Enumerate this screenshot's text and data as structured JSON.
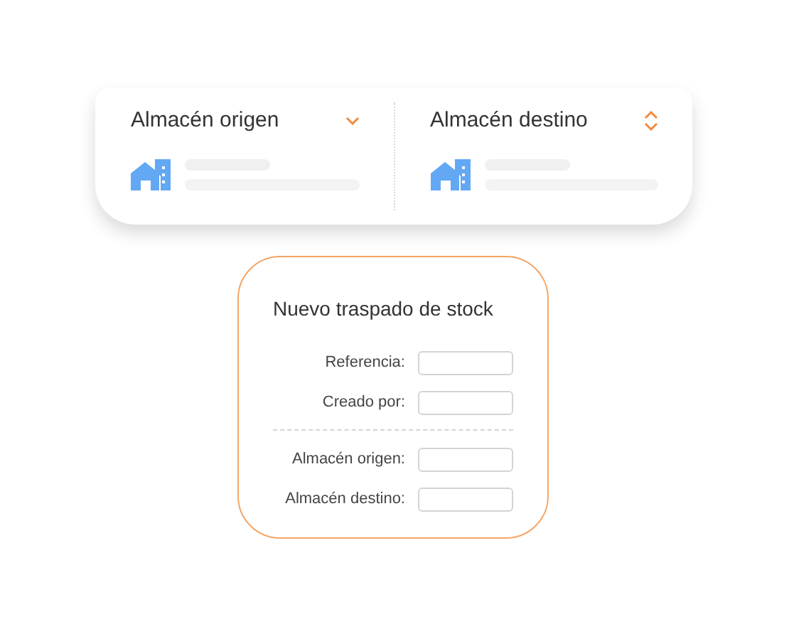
{
  "warehouses": [
    {
      "label": "Almacén origen",
      "kind": "dropdown"
    },
    {
      "label": "Almacén destino",
      "kind": "sorter"
    }
  ],
  "form": {
    "title": "Nuevo traspado de stock",
    "groups": [
      [
        {
          "label": "Referencia:"
        },
        {
          "label": "Creado por:"
        }
      ],
      [
        {
          "label": "Almacén origen:"
        },
        {
          "label": "Almacén destino:"
        }
      ]
    ]
  }
}
